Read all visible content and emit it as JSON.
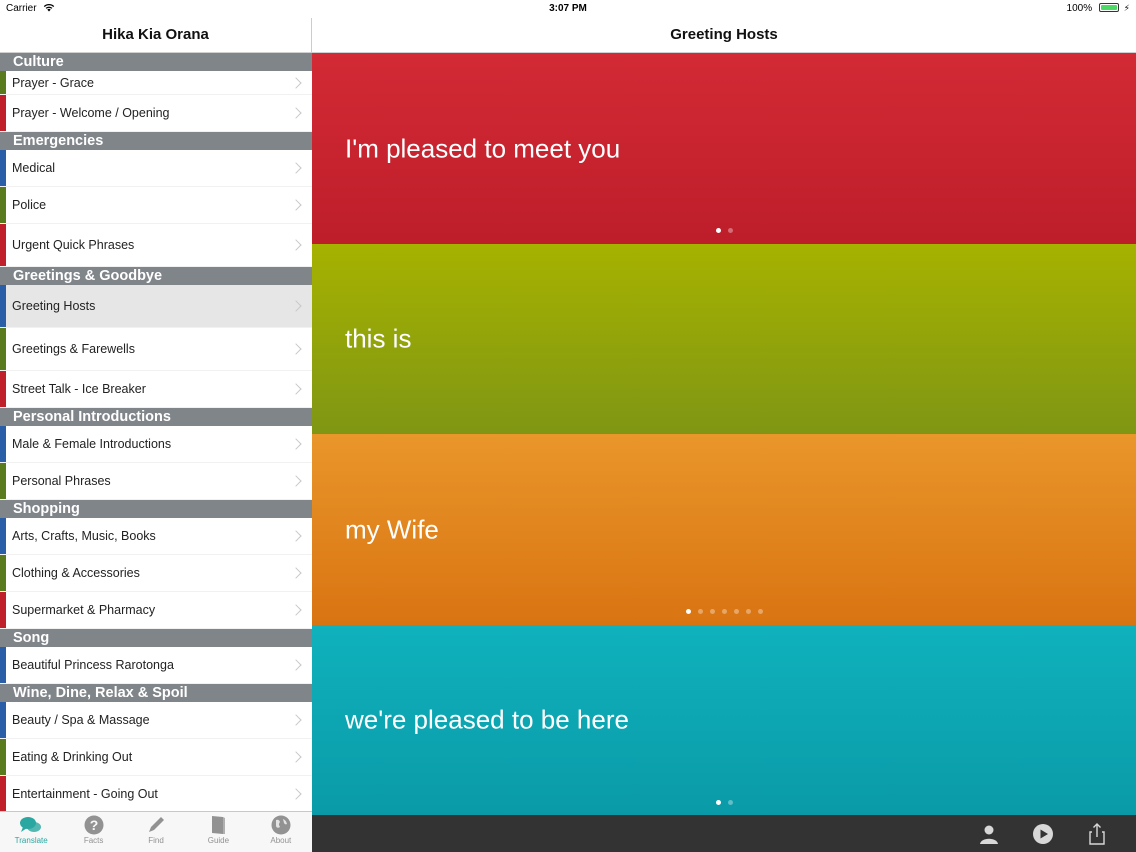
{
  "status_bar": {
    "carrier": "Carrier",
    "time": "3:07 PM",
    "battery": "100%",
    "battery_level": 1.0
  },
  "sidebar": {
    "title": "Hika Kia Orana",
    "sections": [
      {
        "header": "Culture",
        "items": [
          {
            "label": "Prayer - Grace",
            "color": "#5a7a1e"
          },
          {
            "label": "Prayer - Welcome / Opening",
            "color": "#c0202a"
          }
        ]
      },
      {
        "header": "Emergencies",
        "items": [
          {
            "label": "Medical",
            "color": "#2a5fa8"
          },
          {
            "label": "Police",
            "color": "#5a7a1e"
          },
          {
            "label": "Urgent Quick Phrases",
            "color": "#c0202a"
          }
        ]
      },
      {
        "header": "Greetings & Goodbye",
        "items": [
          {
            "label": "Greeting Hosts",
            "color": "#2a5fa8",
            "selected": true
          },
          {
            "label": "Greetings & Farewells",
            "color": "#5a7a1e"
          },
          {
            "label": "Street Talk - Ice Breaker",
            "color": "#c0202a"
          }
        ]
      },
      {
        "header": "Personal Introductions",
        "items": [
          {
            "label": "Male & Female Introductions",
            "color": "#2a5fa8"
          },
          {
            "label": "Personal Phrases",
            "color": "#5a7a1e"
          }
        ]
      },
      {
        "header": "Shopping",
        "items": [
          {
            "label": "Arts, Crafts, Music, Books",
            "color": "#2a5fa8"
          },
          {
            "label": "Clothing & Accessories",
            "color": "#5a7a1e"
          },
          {
            "label": "Supermarket & Pharmacy",
            "color": "#c0202a"
          }
        ]
      },
      {
        "header": "Song",
        "items": [
          {
            "label": "Beautiful Princess Rarotonga",
            "color": "#2a5fa8"
          }
        ]
      },
      {
        "header": "Wine, Dine, Relax & Spoil",
        "items": [
          {
            "label": "Beauty / Spa & Massage",
            "color": "#2a5fa8"
          },
          {
            "label": "Eating & Drinking Out",
            "color": "#5a7a1e"
          },
          {
            "label": "Entertainment - Going Out",
            "color": "#c0202a"
          }
        ]
      }
    ]
  },
  "tabs": [
    {
      "label": "Translate",
      "icon": "chat-bubbles-icon",
      "active": true
    },
    {
      "label": "Facts",
      "icon": "question-icon",
      "active": false
    },
    {
      "label": "Find",
      "icon": "pencil-icon",
      "active": false
    },
    {
      "label": "Guide",
      "icon": "book-icon",
      "active": false
    },
    {
      "label": "About",
      "icon": "globe-icon",
      "active": false
    }
  ],
  "main": {
    "title": "Greeting Hosts",
    "cards": [
      {
        "phrase": "I'm pleased to meet you",
        "color_top": "#d32a35",
        "color_bottom": "#bd1e2a",
        "pages": 2,
        "current": 0
      },
      {
        "phrase": "this is",
        "color_top": "#a6b200",
        "color_bottom": "#7f9614",
        "pages": 0,
        "current": 0
      },
      {
        "phrase": "my Wife",
        "color_top": "#e9962a",
        "color_bottom": "#d97412",
        "pages": 7,
        "current": 0
      },
      {
        "phrase": "we're pleased to be here",
        "color_top": "#0fb2bd",
        "color_bottom": "#0a9aa7",
        "pages": 2,
        "current": 0
      }
    ]
  },
  "toolbar": [
    {
      "icon": "person-icon"
    },
    {
      "icon": "play-icon"
    },
    {
      "icon": "share-icon"
    }
  ]
}
